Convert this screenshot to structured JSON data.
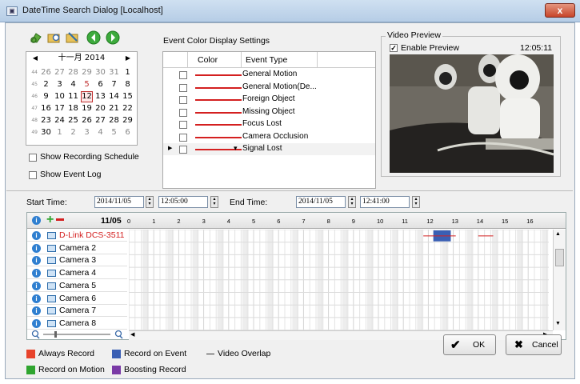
{
  "window": {
    "title": "DateTime Search Dialog [Localhost]",
    "icon_glyph": "▣",
    "close_glyph": "x"
  },
  "toolbar": {
    "icons": [
      "search-leaf-icon",
      "folder-search-icon",
      "playback-folder-icon",
      "back-icon",
      "forward-icon"
    ]
  },
  "calendar": {
    "month_label": "十一月 2014",
    "prev": "◀",
    "next": "▶",
    "weeks": [
      {
        "wk": "44",
        "days": [
          [
            "26",
            1
          ],
          [
            "27",
            1
          ],
          [
            "28",
            1
          ],
          [
            "29",
            1
          ],
          [
            "30",
            1
          ],
          [
            "31",
            1
          ],
          [
            "1",
            0
          ]
        ]
      },
      {
        "wk": "45",
        "days": [
          [
            "2",
            0
          ],
          [
            "3",
            0
          ],
          [
            "4",
            0
          ],
          [
            "5",
            2
          ],
          [
            "6",
            0
          ],
          [
            "7",
            0
          ],
          [
            "8",
            0
          ]
        ]
      },
      {
        "wk": "46",
        "days": [
          [
            "9",
            0
          ],
          [
            "10",
            0
          ],
          [
            "11",
            0
          ],
          [
            "12",
            3
          ],
          [
            "13",
            0
          ],
          [
            "14",
            0
          ],
          [
            "15",
            0
          ]
        ]
      },
      {
        "wk": "47",
        "days": [
          [
            "16",
            0
          ],
          [
            "17",
            0
          ],
          [
            "18",
            0
          ],
          [
            "19",
            0
          ],
          [
            "20",
            0
          ],
          [
            "21",
            0
          ],
          [
            "22",
            0
          ]
        ]
      },
      {
        "wk": "48",
        "days": [
          [
            "23",
            0
          ],
          [
            "24",
            0
          ],
          [
            "25",
            0
          ],
          [
            "26",
            0
          ],
          [
            "27",
            0
          ],
          [
            "28",
            0
          ],
          [
            "29",
            0
          ]
        ]
      },
      {
        "wk": "49",
        "days": [
          [
            "30",
            0
          ],
          [
            "1",
            1
          ],
          [
            "2",
            1
          ],
          [
            "3",
            1
          ],
          [
            "4",
            1
          ],
          [
            "5",
            1
          ],
          [
            "6",
            1
          ]
        ]
      }
    ]
  },
  "options": {
    "show_recording_schedule": "Show Recording Schedule",
    "show_event_log": "Show Event Log"
  },
  "event_colors": {
    "title": "Event Color Display Settings",
    "col_color": "Color",
    "col_event": "Event Type",
    "rows": [
      "General Motion",
      "General Motion(De...",
      "Foreign Object",
      "Missing Object",
      "Focus Lost",
      "Camera Occlusion",
      "Signal Lost"
    ],
    "color": "#d42020"
  },
  "video_preview": {
    "title": "Video Preview",
    "enable_label": "Enable Preview",
    "check_glyph": "✓",
    "time": "12:05:11"
  },
  "time_range": {
    "start_label": "Start Time:",
    "start_date": "2014/11/05",
    "start_time": "12:05:00",
    "end_label": "End Time:",
    "end_date": "2014/11/05",
    "end_time": "12:41:00"
  },
  "schedule": {
    "date": "11/05",
    "info_glyph": "i",
    "hours": [
      "0",
      "1",
      "2",
      "3",
      "4",
      "5",
      "6",
      "7",
      "8",
      "9",
      "10",
      "11",
      "12",
      "13",
      "14",
      "15",
      "16"
    ],
    "cameras": [
      {
        "name": "D-Link DCS-3511",
        "color": "#d42020"
      },
      {
        "name": "Camera 2",
        "color": "#000000"
      },
      {
        "name": "Camera 3",
        "color": "#000000"
      },
      {
        "name": "Camera 4",
        "color": "#000000"
      },
      {
        "name": "Camera 5",
        "color": "#000000"
      },
      {
        "name": "Camera 6",
        "color": "#000000"
      },
      {
        "name": "Camera 7",
        "color": "#000000"
      },
      {
        "name": "Camera 8",
        "color": "#000000"
      }
    ],
    "recordings": [
      {
        "camera": 0,
        "start_hour": 12.2,
        "end_hour": 12.9,
        "kind": "event"
      },
      {
        "camera": 0,
        "start_hour": 11.8,
        "end_hour": 13.1,
        "kind": "overlap"
      },
      {
        "camera": 0,
        "start_hour": 14.0,
        "end_hour": 14.6,
        "kind": "overlap"
      }
    ]
  },
  "legend": {
    "always": {
      "label": "Always Record",
      "color": "#e8432b"
    },
    "event": {
      "label": "Record on Event",
      "color": "#3a5fb4"
    },
    "overlap": {
      "label": "Video Overlap"
    },
    "motion": {
      "label": "Record on Motion",
      "color": "#2fa52f"
    },
    "boost": {
      "label": "Boosting Record",
      "color": "#7a3aa6"
    }
  },
  "buttons": {
    "ok": "OK",
    "ok_glyph": "✔",
    "cancel": "Cancel",
    "cancel_glyph": "✖"
  }
}
